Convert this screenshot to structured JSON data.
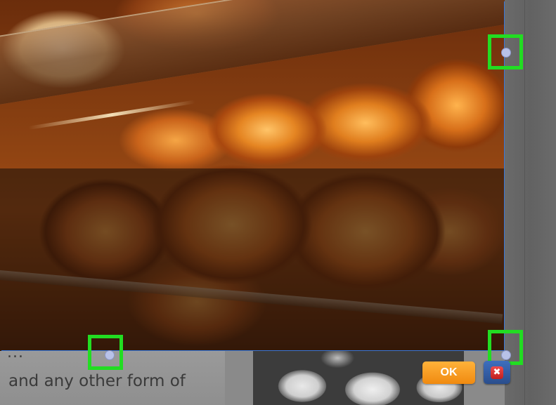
{
  "background_text": {
    "partial_line": "...",
    "body_line": "and any other form of"
  },
  "crop_tool": {
    "ok_label": "OK",
    "cancel_icon": "close-icon",
    "cancel_glyph": "✖",
    "handle_color": "#22dd22",
    "selection_border_color": "#3a78d8"
  },
  "colors": {
    "ok_button": "#f08a10",
    "cancel_button": "#2a4e8c"
  }
}
